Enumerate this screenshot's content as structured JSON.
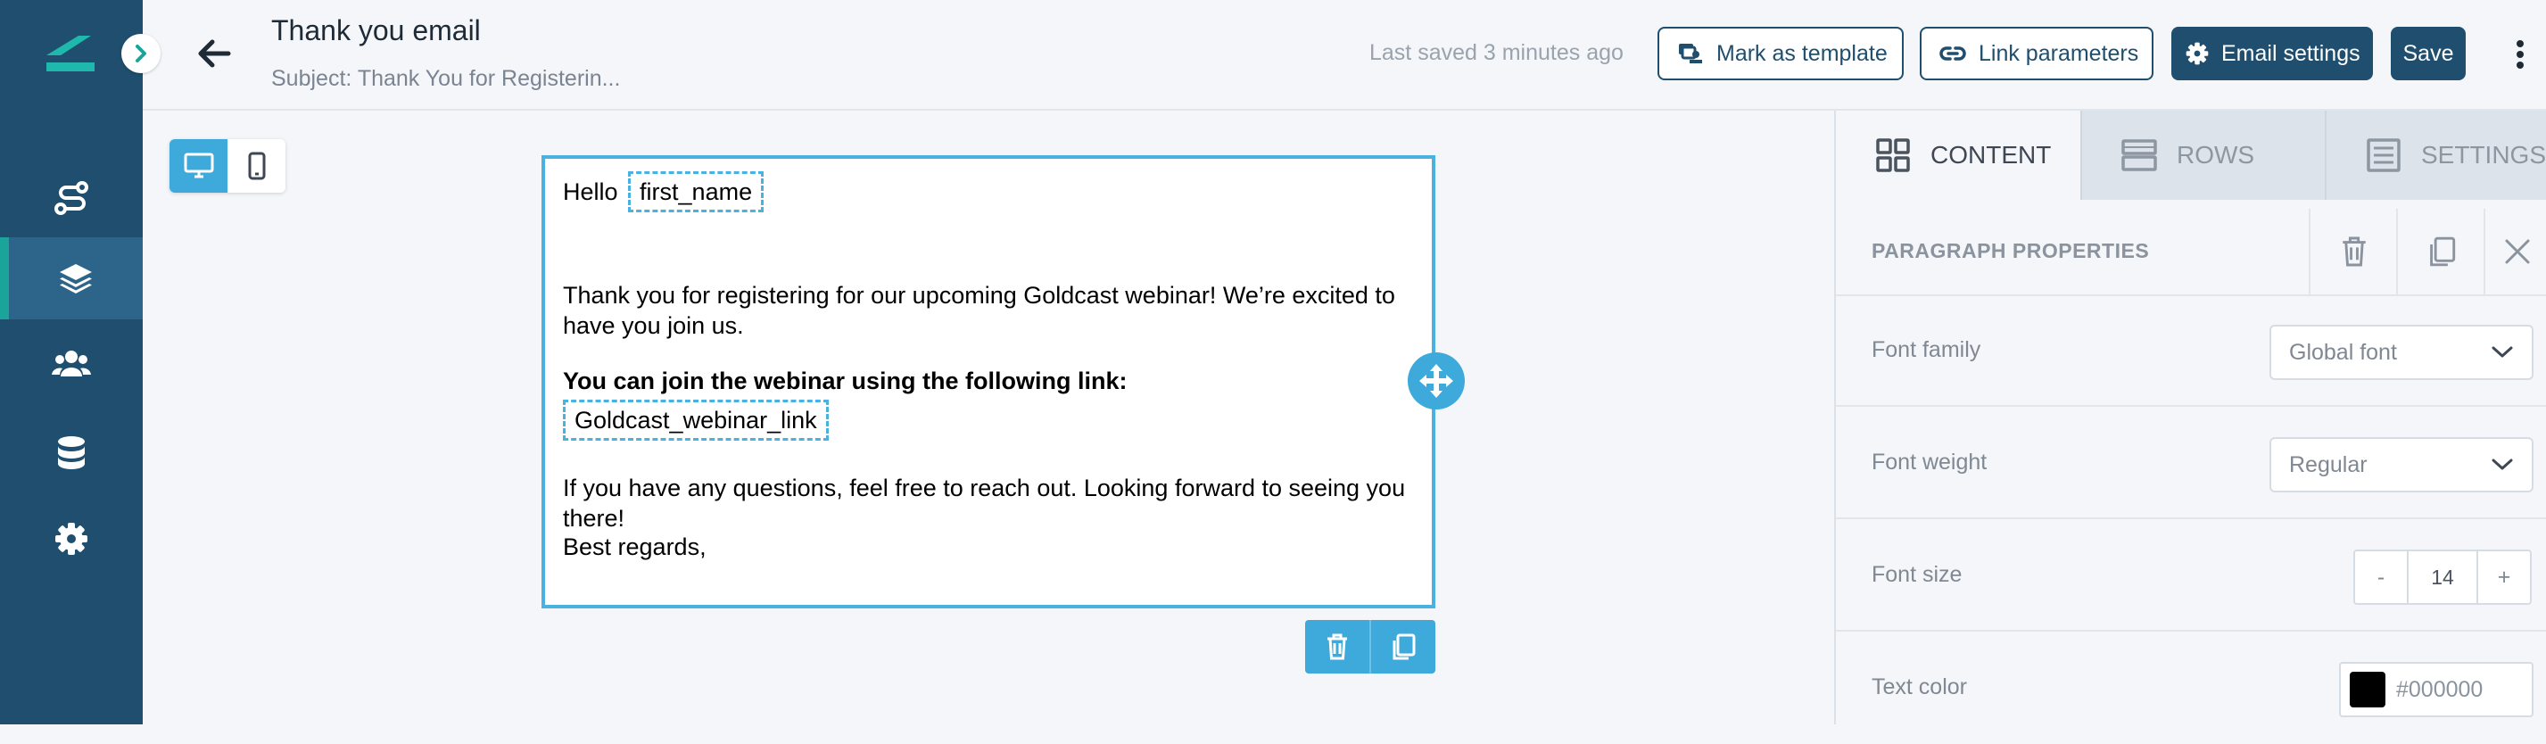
{
  "nav": {
    "items": [
      {
        "name": "journeys",
        "icon": "route-icon",
        "active": false
      },
      {
        "name": "templates",
        "icon": "layers-icon",
        "active": true
      },
      {
        "name": "audience",
        "icon": "users-icon",
        "active": false
      },
      {
        "name": "data",
        "icon": "database-icon",
        "active": false
      },
      {
        "name": "settings",
        "icon": "gear-icon",
        "active": false
      }
    ]
  },
  "header": {
    "title": "Thank you email",
    "subject": "Subject: Thank You for Registerin...",
    "last_saved": "Last saved 3 minutes ago",
    "mark_template_label": "Mark as template",
    "link_params_label": "Link parameters",
    "email_settings_label": "Email settings",
    "save_label": "Save"
  },
  "canvas": {
    "device_toggle": {
      "selected": "desktop"
    },
    "email": {
      "greeting": "Hello",
      "first_name_tag": "first_name",
      "para1": "Thank you for registering for our upcoming Goldcast webinar! We’re excited to have you join us.",
      "link_intro": "You can join the webinar using the following link:",
      "link_tag": "Goldcast_webinar_link",
      "para3": "If you have any questions, feel free to reach out. Looking forward to seeing you there!",
      "closing": "Best regards,"
    }
  },
  "panel": {
    "tabs": [
      {
        "label": "CONTENT",
        "icon": "grid-icon",
        "active": true
      },
      {
        "label": "ROWS",
        "icon": "rows-icon",
        "active": false
      },
      {
        "label": "SETTINGS",
        "icon": "settings-list-icon",
        "active": false
      }
    ],
    "properties_title": "PARAGRAPH PROPERTIES",
    "font_family": {
      "label": "Font family",
      "value": "Global font"
    },
    "font_weight": {
      "label": "Font weight",
      "value": "Regular"
    },
    "font_size": {
      "label": "Font size",
      "value": "14",
      "decrement": "-",
      "increment": "+"
    },
    "text_color": {
      "label": "Text color",
      "value": "#000000"
    }
  },
  "colors": {
    "sidebar": "#1f4e6e",
    "accent": "#3ea9db",
    "teal": "#1aa49a",
    "primary_button": "#1f4e6e"
  }
}
